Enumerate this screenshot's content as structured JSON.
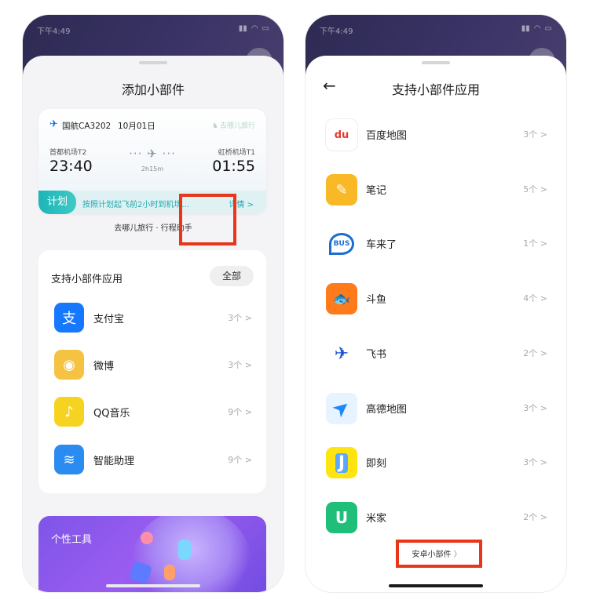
{
  "left": {
    "sheet_title": "添加小部件",
    "flight_widget": {
      "flight_no": "国航CA3202",
      "date": "10月01日",
      "brand": "去哪儿旅行",
      "departure_airport": "首都机场T2",
      "departure_time": "23:40",
      "duration": "2h15m",
      "arrival_airport": "虹桥机场T1",
      "arrival_time": "01:55",
      "plan_badge": "计划",
      "plan_text": "按照计划起飞前2小时到机场...",
      "detail_link": "详情 >"
    },
    "flight_caption": "去哪儿旅行 · 行程助手",
    "apps_card": {
      "title": "支持小部件应用",
      "all_button": "全部",
      "apps": [
        {
          "name": "支付宝",
          "count": "3个 >",
          "color": "#1677ff",
          "icon": "alipay-icon",
          "glyph": "支"
        },
        {
          "name": "微博",
          "count": "3个 >",
          "color": "#f5c242",
          "icon": "weibo-icon",
          "glyph": "◉"
        },
        {
          "name": "QQ音乐",
          "count": "9个 >",
          "color": "#f7d321",
          "icon": "qq-music-icon",
          "glyph": "♪"
        },
        {
          "name": "智能助理",
          "count": "9个 >",
          "color": "#2a8cf0",
          "icon": "smart-assistant-icon",
          "glyph": "≋"
        }
      ]
    },
    "tools_card": {
      "title": "个性工具"
    }
  },
  "right": {
    "sheet_title": "支持小部件应用",
    "apps": [
      {
        "name": "百度地图",
        "count": "3个 >",
        "color": "#ffffff",
        "icon": "baidu-map-icon",
        "glyph": "du"
      },
      {
        "name": "笔记",
        "count": "5个 >",
        "color": "#f9b826",
        "icon": "notes-icon",
        "glyph": "✎"
      },
      {
        "name": "车来了",
        "count": "1个 >",
        "color": "#ffffff",
        "icon": "chelaile-icon",
        "glyph": "BUS"
      },
      {
        "name": "斗鱼",
        "count": "4个 >",
        "color": "#ff7a1a",
        "icon": "douyu-icon",
        "glyph": "🐟"
      },
      {
        "name": "飞书",
        "count": "2个 >",
        "color": "#ffffff",
        "icon": "feishu-icon",
        "glyph": "✈"
      },
      {
        "name": "高德地图",
        "count": "3个 >",
        "color": "#e7f4ff",
        "icon": "amap-icon",
        "glyph": "➤"
      },
      {
        "name": "即刻",
        "count": "3个 >",
        "color": "#ffe411",
        "icon": "jike-icon",
        "glyph": "J"
      },
      {
        "name": "米家",
        "count": "2个 >",
        "color": "#1fbf7a",
        "icon": "mijia-icon",
        "glyph": "U"
      }
    ],
    "android_widgets_button": "安卓小部件"
  },
  "status_bar": {
    "time": "下午4:49"
  }
}
